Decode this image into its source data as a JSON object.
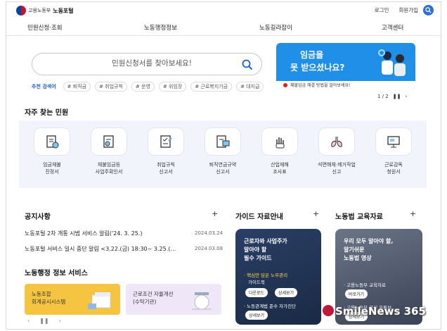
{
  "header": {
    "ministry": "고용노동부",
    "portal": "노동포털",
    "login": "로그인",
    "signup": "회원가입"
  },
  "gnb": [
    "민원신청·조회",
    "노동행정정보",
    "노동길라잡이",
    "고객센터"
  ],
  "search": {
    "placeholder": "민원신청서를 찾아보세요!",
    "reco_label": "추천 검색어",
    "tags": [
      "# 퇴직금",
      "# 취업규칙",
      "# 운영",
      "# 위임장",
      "# 근로복지기금",
      "# 대지급"
    ]
  },
  "banner": {
    "line1": "임금을",
    "line2": "못 받으셨나요?",
    "caption": "체불임금 해결 방법을 알아보세요!",
    "pager": "1 / 2"
  },
  "frequent": {
    "title": "자주 찾는 민원",
    "items": [
      {
        "label": "임금체불\n진정서",
        "icon": "wage-complaint-icon"
      },
      {
        "label": "체불임금등\n사업주확인서",
        "icon": "confirmation-doc-icon"
      },
      {
        "label": "취업규칙\n신고서",
        "icon": "rules-report-icon"
      },
      {
        "label": "퇴직연금규약\n신고서",
        "icon": "pension-report-icon"
      },
      {
        "label": "산업재해\n조사표",
        "icon": "injury-hand-icon"
      },
      {
        "label": "석면해체·제거작업\n신고",
        "icon": "lungs-icon"
      },
      {
        "label": "근로감독\n청원서",
        "icon": "monitor-icon"
      }
    ]
  },
  "notices": {
    "title": "공지사항",
    "plus": "+",
    "items": [
      {
        "text": "노동포털 2차 개통 시범 서비스 알림('24. 3. 25.)",
        "date": "2024.03.24"
      },
      {
        "text": "노동포털 서비스 일시 중단 알림 <3.22.(금) 18:30~ 3.25.(…",
        "date": "2024.03.08"
      }
    ]
  },
  "services": {
    "title": "노동행정 정보 서비스",
    "items": [
      "노동조합\n회계공시시스템",
      "근로조건 자율개선\n(수탁기관)"
    ]
  },
  "guide": {
    "title": "가이드 자료안내",
    "plus": "+",
    "card_title": "근로자와 사업주가\n알아야 할\n필수 가이드",
    "line1": "· 핵심만 담은 노무관리",
    "line1b": "가이드북",
    "btn_download": "다운로드",
    "btn_detail": "상세보기",
    "line2": "· 노동관계법 준수 자가진단",
    "btn_detail2": "상세보기"
  },
  "edu": {
    "title": "노동법 교육자료",
    "plus": "+",
    "card_title": "우리 모두 알아야 할,\n알기쉬운\n노동법 영상",
    "line1": "· 고용노동부 교육자료",
    "btn_go": "바로가기",
    "line2": "· 고용노동부 공식 유튜브",
    "btn_detail": "상세보기"
  },
  "watermark": "SmileNews 365",
  "colors": {
    "accent": "#1d5fd1",
    "banner": "#1f8fe8",
    "freq_bg": "#f1f5fb",
    "svc1": "#f5c542",
    "svc2": "#efe6f7"
  }
}
